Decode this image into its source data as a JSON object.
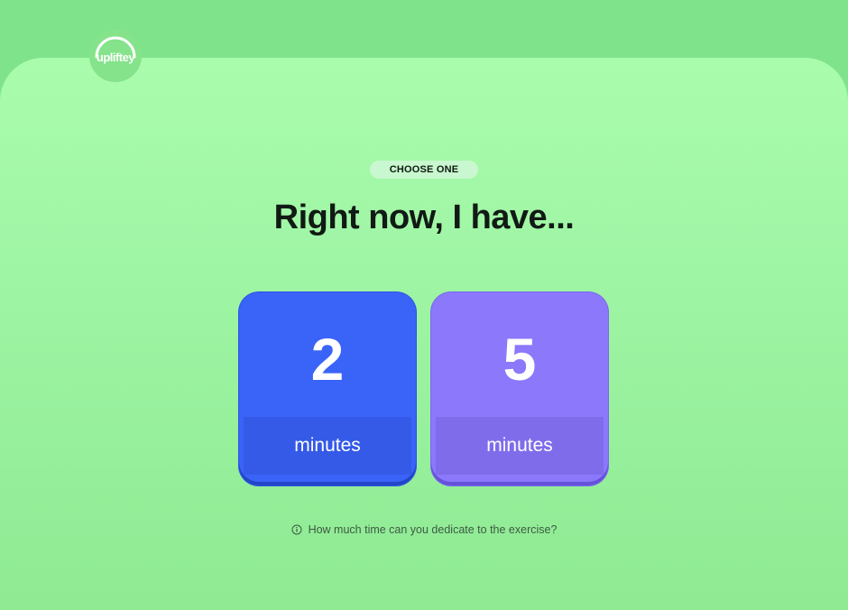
{
  "brand": {
    "logo_text": "upliftey"
  },
  "prompt": {
    "chip_label": "CHOOSE ONE",
    "title": "Right now, I have..."
  },
  "options": [
    {
      "value": "2",
      "unit": "minutes",
      "color": "#3a63f7"
    },
    {
      "value": "5",
      "unit": "minutes",
      "color": "#8b78fb"
    }
  ],
  "hint": {
    "icon": "info-icon",
    "text": "How much time can you dedicate to the exercise?"
  },
  "colors": {
    "background": "#7fe38c",
    "panel": "#a9fcac",
    "title_text": "#111a14"
  }
}
